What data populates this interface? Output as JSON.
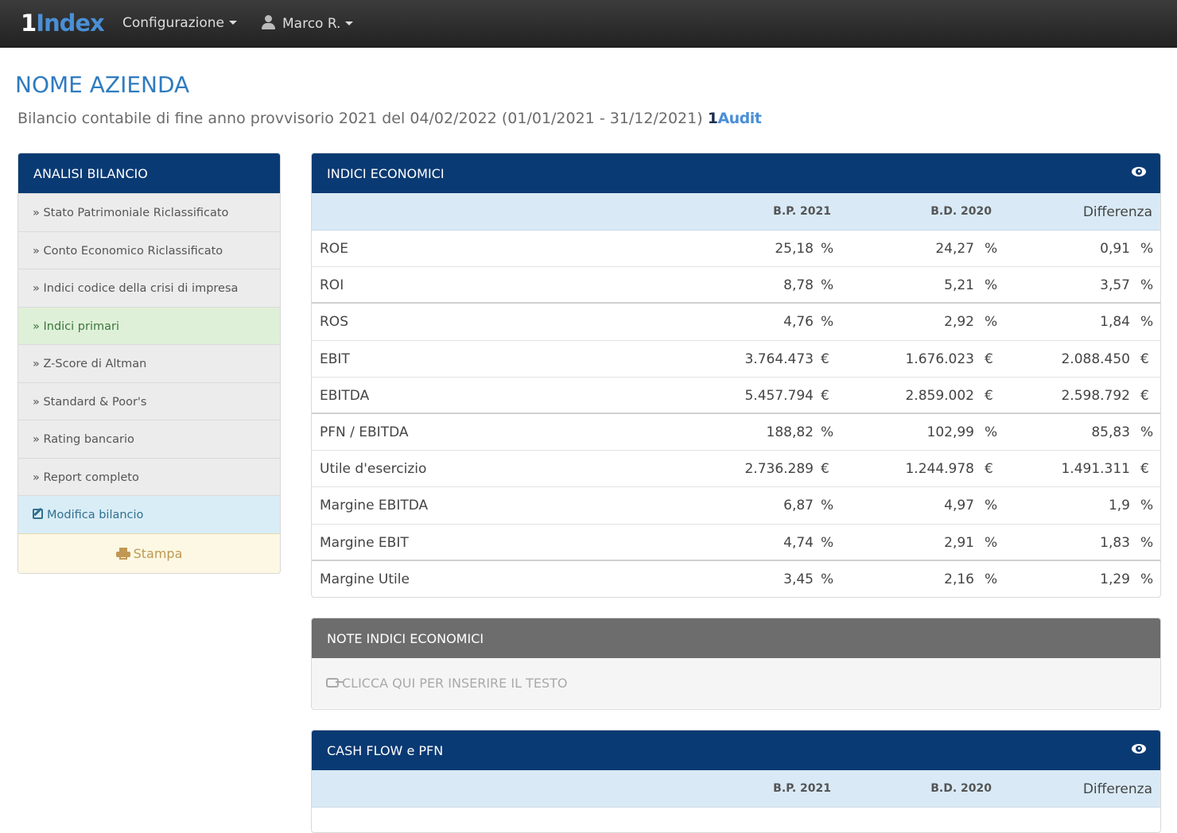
{
  "navbar": {
    "brand_one": "1",
    "brand_rest": "Index",
    "config_label": "Configurazione",
    "user_label": "Marco R."
  },
  "header": {
    "title": "NOME AZIENDA",
    "subtitle": "Bilancio contabile di fine anno provvisorio 2021 del 04/02/2022 (01/01/2021 - 31/12/2021)",
    "audit_one": "1",
    "audit_rest": "Audit"
  },
  "sidebar": {
    "title": "ANALISI BILANCIO",
    "items": [
      {
        "label": "» Stato Patrimoniale Riclassificato"
      },
      {
        "label": "» Conto Economico Riclassificato"
      },
      {
        "label": "» Indici codice della crisi di impresa"
      },
      {
        "label": "» Indici primari"
      },
      {
        "label": "» Z-Score di Altman"
      },
      {
        "label": "» Standard & Poor's"
      },
      {
        "label": "» Rating bancario"
      },
      {
        "label": "» Report completo"
      }
    ],
    "edit_label": "Modifica bilancio",
    "print_label": "Stampa"
  },
  "indici": {
    "title": "INDICI ECONOMICI",
    "col1": "B.P. 2021",
    "col2": "B.D. 2020",
    "col3": "Differenza",
    "rows": [
      {
        "label": "ROE",
        "v1": "25,18",
        "v2": "24,27",
        "v3": "0,91",
        "unit": "%"
      },
      {
        "label": "ROI",
        "v1": "8,78",
        "v2": "5,21",
        "v3": "3,57",
        "unit": "%"
      },
      {
        "label": "ROS",
        "v1": "4,76",
        "v2": "2,92",
        "v3": "1,84",
        "unit": "%"
      },
      {
        "label": "EBIT",
        "v1": "3.764.473",
        "v2": "1.676.023",
        "v3": "2.088.450",
        "unit": "€"
      },
      {
        "label": "EBITDA",
        "v1": "5.457.794",
        "v2": "2.859.002",
        "v3": "2.598.792",
        "unit": "€"
      },
      {
        "label": "PFN / EBITDA",
        "v1": "188,82",
        "v2": "102,99",
        "v3": "85,83",
        "unit": "%"
      },
      {
        "label": "Utile d'esercizio",
        "v1": "2.736.289",
        "v2": "1.244.978",
        "v3": "1.491.311",
        "unit": "€"
      },
      {
        "label": "Margine EBITDA",
        "v1": "6,87",
        "v2": "4,97",
        "v3": "1,9",
        "unit": "%"
      },
      {
        "label": "Margine EBIT",
        "v1": "4,74",
        "v2": "2,91",
        "v3": "1,83",
        "unit": "%"
      },
      {
        "label": "Margine Utile",
        "v1": "3,45",
        "v2": "2,16",
        "v3": "1,29",
        "unit": "%"
      }
    ]
  },
  "note": {
    "title": "NOTE INDICI ECONOMICI",
    "placeholder": "CLICCA QUI PER INSERIRE IL TESTO"
  },
  "cashflow": {
    "title": "CASH FLOW e PFN",
    "col1": "B.P. 2021",
    "col2": "B.D. 2020",
    "col3": "Differenza"
  }
}
